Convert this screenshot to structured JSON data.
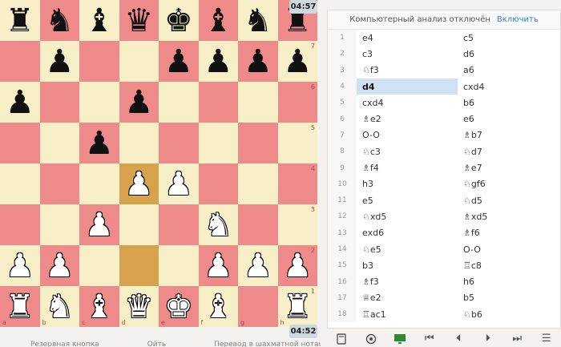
{
  "clocks": {
    "top": "04:57",
    "bottom": "04:52"
  },
  "board": {
    "ranks": [
      "8",
      "7",
      "6",
      "5",
      "4",
      "3",
      "2",
      "1"
    ],
    "files": [
      "a",
      "b",
      "c",
      "d",
      "e",
      "f",
      "g",
      "h"
    ],
    "highlight": [
      "d2",
      "d4"
    ],
    "position": [
      [
        "bR",
        "bN",
        "bB",
        "bQ",
        "bK",
        "bB",
        "bN",
        "bR"
      ],
      [
        "",
        "bP",
        "",
        "",
        "bP",
        "bP",
        "bP",
        "bP"
      ],
      [
        "bP",
        "",
        "",
        "bP",
        "",
        "",
        "",
        ""
      ],
      [
        "",
        "",
        "bP",
        "",
        "",
        "",
        "",
        ""
      ],
      [
        "",
        "",
        "",
        "wP",
        "wP",
        "",
        "",
        ""
      ],
      [
        "",
        "",
        "wP",
        "",
        "",
        "wN",
        "",
        ""
      ],
      [
        "wP",
        "wP",
        "",
        "",
        "",
        "wP",
        "wP",
        "wP"
      ],
      [
        "wR",
        "wN",
        "wB",
        "wQ",
        "wK",
        "wB",
        "",
        "wR"
      ]
    ]
  },
  "analysis": {
    "text": "Компьютерный анализ отключён",
    "link": "Включить"
  },
  "moves": [
    {
      "n": "1",
      "w": "e4",
      "b": "c5"
    },
    {
      "n": "2",
      "w": "c3",
      "b": "d6"
    },
    {
      "n": "3",
      "w": "♘f3",
      "b": "a6"
    },
    {
      "n": "4",
      "w": "d4",
      "b": "cxd4"
    },
    {
      "n": "5",
      "w": "cxd4",
      "b": "b6"
    },
    {
      "n": "6",
      "w": "♗e2",
      "b": "e6"
    },
    {
      "n": "7",
      "w": "O-O",
      "b": "♗b7"
    },
    {
      "n": "8",
      "w": "♘c3",
      "b": "♘d7"
    },
    {
      "n": "9",
      "w": "♗f4",
      "b": "♗e7"
    },
    {
      "n": "10",
      "w": "h3",
      "b": "♘gf6"
    },
    {
      "n": "11",
      "w": "e5",
      "b": "♘d5"
    },
    {
      "n": "12",
      "w": "♘xd5",
      "b": "♗xd5"
    },
    {
      "n": "13",
      "w": "exd6",
      "b": "♗f6"
    },
    {
      "n": "14",
      "w": "♘e5",
      "b": "O-O"
    },
    {
      "n": "15",
      "w": "b3",
      "b": "♖c8"
    },
    {
      "n": "16",
      "w": "♗f3",
      "b": "h6"
    },
    {
      "n": "17",
      "w": "♕e2",
      "b": "b5"
    },
    {
      "n": "18",
      "w": "♖ac1",
      "b": "♘b6"
    }
  ],
  "active_move": {
    "row": 3,
    "side": "w"
  },
  "toolbar": {
    "book": "book-icon",
    "target": "target-icon",
    "computer": "computer-icon",
    "first": "⏮",
    "prev": "⏴",
    "next": "⏵",
    "last": "⏭",
    "menu": "☰"
  },
  "bottom_text": [
    "Резервная кнопка",
    "Ойть",
    "Перевод в шахматной нотации"
  ],
  "colors": {
    "light": "#f6efc8",
    "dark": "#ee8a8a",
    "highlight": "#d6a24b",
    "active_move": "#cfe1f3"
  }
}
